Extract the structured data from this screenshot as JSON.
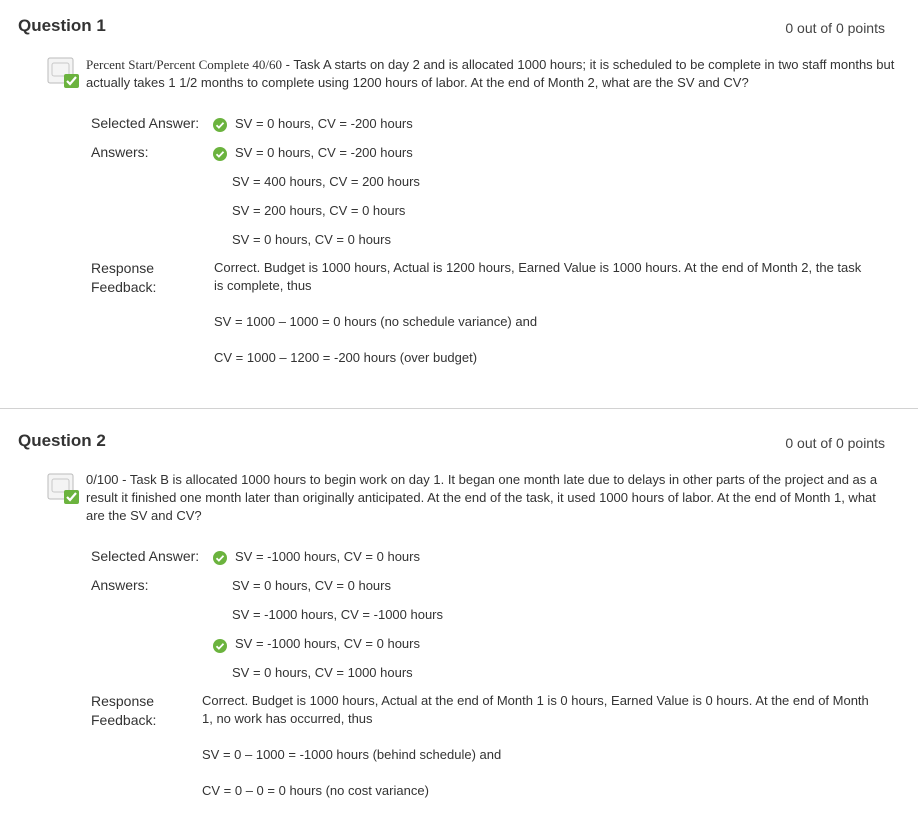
{
  "q1": {
    "title": "Question 1",
    "points": "0 out of 0 points",
    "text_prefix": "Percent Start/Percent Complete 40/60",
    "text_rest": " - Task A starts on day 2 and is allocated 1000 hours; it is scheduled to be complete in two staff months but actually takes 1 1/2 months to complete using 1200 hours of labor. At the end of Month 2, what are the SV and CV?",
    "selected_label": "Selected Answer:",
    "selected_answer": "SV = 0 hours, CV = -200 hours",
    "answers_label": "Answers:",
    "answers": [
      "SV = 0 hours, CV = -200 hours",
      "SV = 400 hours, CV = 200 hours",
      "SV = 200 hours, CV = 0 hours",
      "SV = 0 hours, CV = 0 hours"
    ],
    "feedback_label": "Response Feedback:",
    "feedback": [
      "Correct. Budget is 1000 hours, Actual is 1200 hours, Earned Value is 1000 hours.  At the end of Month 2, the task is complete, thus",
      "SV = 1000 – 1000 = 0 hours (no schedule variance) and",
      "CV = 1000 – 1200 = -200 hours (over budget)"
    ]
  },
  "q2": {
    "title": "Question 2",
    "points": "0 out of 0 points",
    "text": "0/100 - Task B is allocated 1000 hours to begin work on day 1.  It began one month late due to delays in other parts of the project and as a result it finished one month later than originally anticipated.  At the end of the task, it used 1000 hours of labor. At the end of Month 1, what are the SV and CV?",
    "selected_label": "Selected Answer:",
    "selected_answer": "SV = -1000 hours, CV = 0 hours",
    "answers_label": "Answers:",
    "answers": [
      "SV = 0 hours, CV = 0 hours",
      "SV = -1000 hours, CV = -1000 hours",
      "SV = -1000 hours, CV = 0 hours",
      "SV = 0 hours, CV = 1000 hours"
    ],
    "feedback_label": "Response Feedback:",
    "feedback": [
      "Correct.  Budget is 1000 hours, Actual at the end of Month 1 is 0 hours, Earned Value is 0 hours. At the end of Month 1, no work has occurred, thus",
      "SV = 0 – 1000 = -1000 hours (behind schedule) and",
      "CV = 0 – 0 = 0 hours (no cost variance)"
    ]
  },
  "colors": {
    "correct_green": "#6bb33e",
    "divider": "#d2d2d2"
  },
  "icons": {
    "question_status": "correct-checkmark-icon",
    "answer_correct": "check-circle-icon"
  }
}
